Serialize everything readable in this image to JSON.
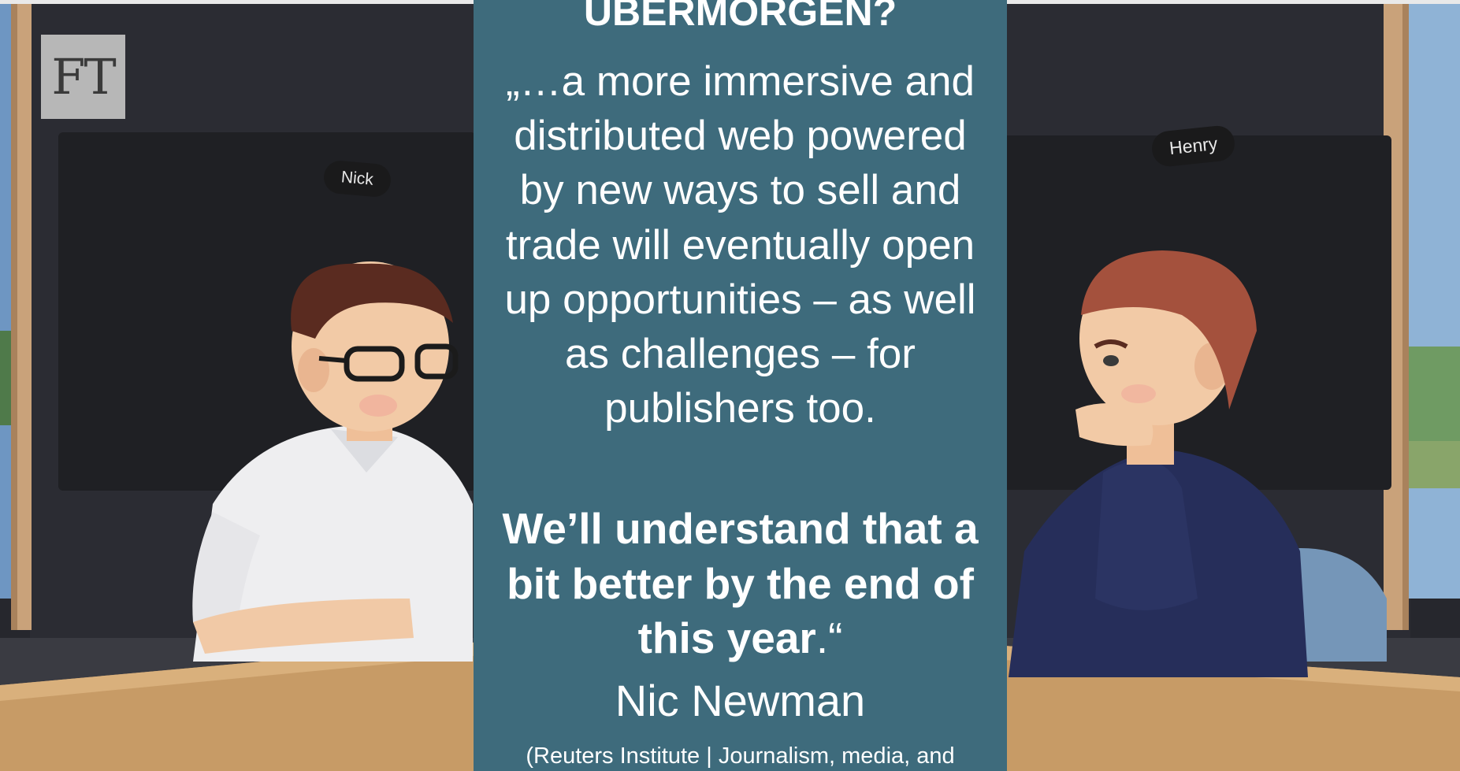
{
  "logo": {
    "text": "FT"
  },
  "participants": {
    "left_name": "Nick",
    "right_name": "Henry"
  },
  "quote": {
    "heading": "UBERMORGEN?",
    "body": "„…a more immersive and distributed web powered by new ways to sell and trade will eventually open up opportunities – as well as challenges – for publishers too.",
    "emphasis": "We’ll understand that a bit better by the end of this year",
    "emphasis_tail": ".“",
    "author": "Nic Newman",
    "source": "(Reuters Institute | Journalism, media, and"
  },
  "colors": {
    "quote_panel": "#3e6b7c",
    "quote_text": "#ffffff",
    "logo_bg": "#b7b7b7"
  }
}
